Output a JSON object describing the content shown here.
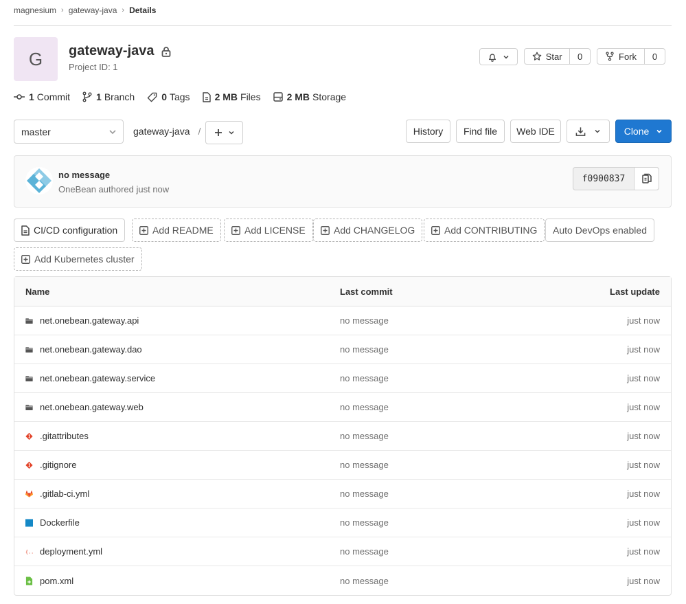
{
  "breadcrumb": [
    "magnesium",
    "gateway-java",
    "Details"
  ],
  "project": {
    "avatar_letter": "G",
    "name": "gateway-java",
    "id_label": "Project ID: 1"
  },
  "actions": {
    "star_label": "Star",
    "star_count": "0",
    "fork_label": "Fork",
    "fork_count": "0"
  },
  "stats": {
    "commits": {
      "value": "1",
      "label": "Commit"
    },
    "branches": {
      "value": "1",
      "label": "Branch"
    },
    "tags": {
      "value": "0",
      "label": "Tags"
    },
    "files": {
      "value": "2 MB",
      "label": "Files"
    },
    "storage": {
      "value": "2 MB",
      "label": "Storage"
    }
  },
  "toolbar": {
    "branch": "master",
    "path_root": "gateway-java",
    "path_sep": "/",
    "history": "History",
    "find_file": "Find file",
    "web_ide": "Web IDE",
    "clone": "Clone"
  },
  "last_commit": {
    "message": "no message",
    "author": "OneBean authored just now",
    "sha": "f0900837"
  },
  "quick_links": {
    "cicd": "CI/CD configuration",
    "readme": "Add README",
    "license": "Add LICENSE",
    "changelog": "Add CHANGELOG",
    "contributing": "Add CONTRIBUTING",
    "autodevops": "Auto DevOps enabled",
    "kubernetes": "Add Kubernetes cluster"
  },
  "table": {
    "headers": {
      "name": "Name",
      "last_commit": "Last commit",
      "last_update": "Last update"
    },
    "rows": [
      {
        "name": "net.onebean.gateway.api",
        "icon": "folder-icon",
        "commit": "no message",
        "update": "just now"
      },
      {
        "name": "net.onebean.gateway.dao",
        "icon": "folder-icon",
        "commit": "no message",
        "update": "just now"
      },
      {
        "name": "net.onebean.gateway.service",
        "icon": "folder-icon",
        "commit": "no message",
        "update": "just now"
      },
      {
        "name": "net.onebean.gateway.web",
        "icon": "folder-icon",
        "commit": "no message",
        "update": "just now"
      },
      {
        "name": ".gitattributes",
        "icon": "git-icon",
        "commit": "no message",
        "update": "just now"
      },
      {
        "name": ".gitignore",
        "icon": "git-icon",
        "commit": "no message",
        "update": "just now"
      },
      {
        "name": ".gitlab-ci.yml",
        "icon": "gitlab-icon",
        "commit": "no message",
        "update": "just now"
      },
      {
        "name": "Dockerfile",
        "icon": "docker-icon",
        "commit": "no message",
        "update": "just now"
      },
      {
        "name": "deployment.yml",
        "icon": "yaml-icon",
        "commit": "no message",
        "update": "just now"
      },
      {
        "name": "pom.xml",
        "icon": "maven-icon",
        "commit": "no message",
        "update": "just now"
      }
    ]
  },
  "colors": {
    "primary": "#1f78d1",
    "avatar_bg": "#f0e5f3",
    "git_orange": "#e24329",
    "docker_blue": "#1488c6"
  }
}
